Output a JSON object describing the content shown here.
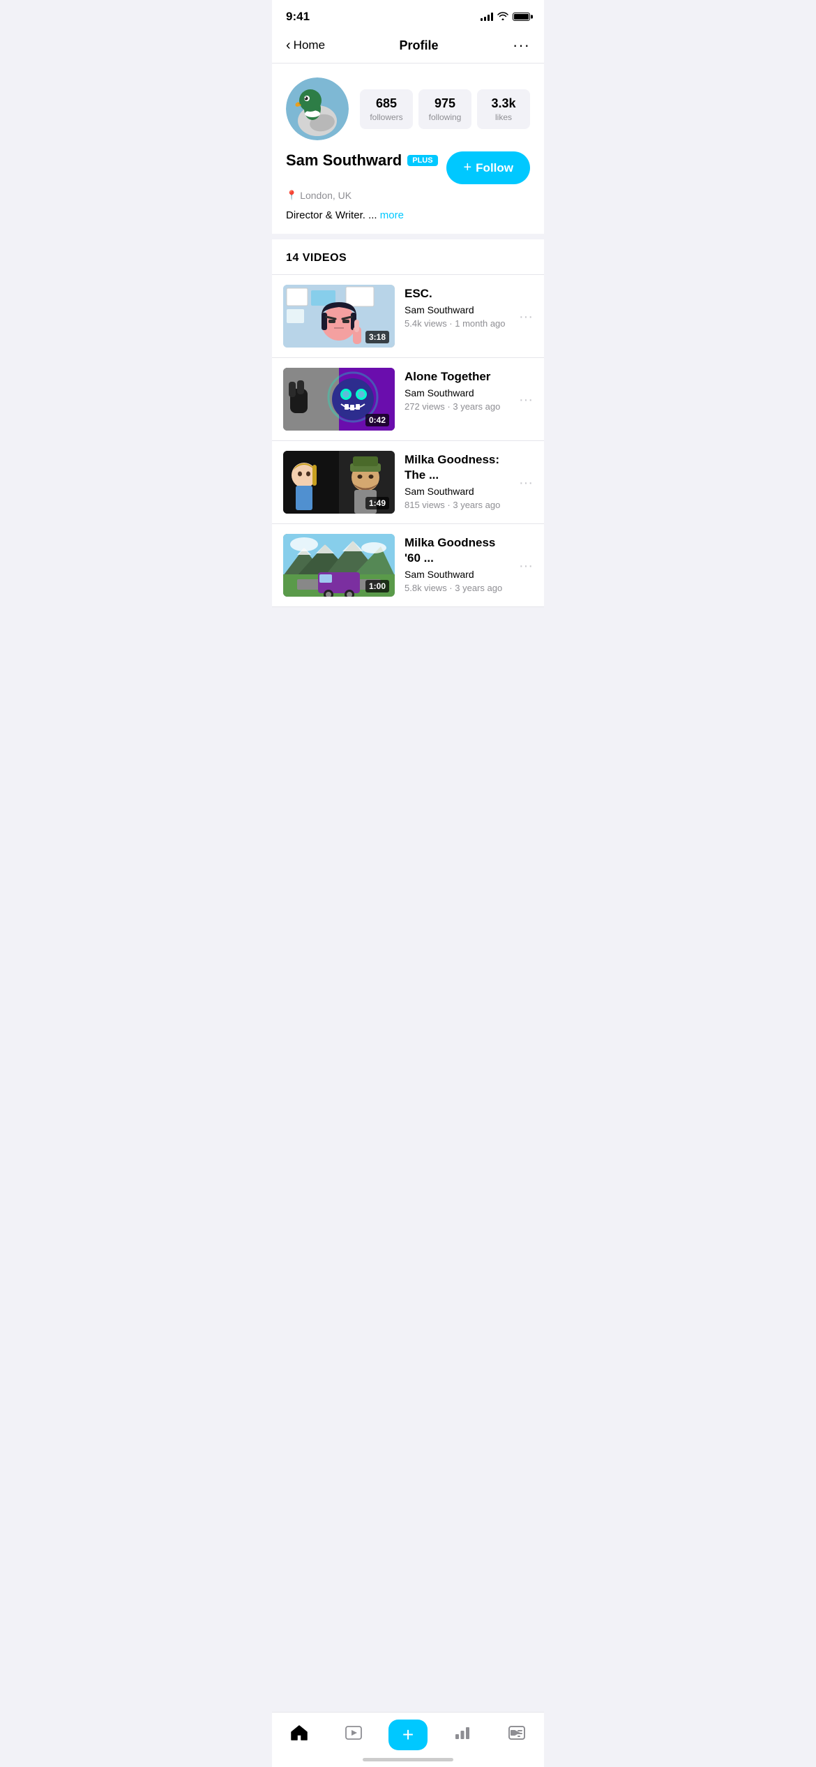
{
  "statusBar": {
    "time": "9:41"
  },
  "navBar": {
    "back_label": "Home",
    "title": "Profile",
    "more": "···"
  },
  "profile": {
    "name": "Sam Southward",
    "badge": "PLUS",
    "location": "London, UK",
    "bio": "Director & Writer.",
    "bio_more": "more",
    "follow_label": "Follow",
    "stats": [
      {
        "number": "685",
        "label": "followers"
      },
      {
        "number": "975",
        "label": "following"
      },
      {
        "number": "3.3k",
        "label": "likes"
      }
    ]
  },
  "videosSection": {
    "header": "14 VIDEOS"
  },
  "videos": [
    {
      "title": "ESC.",
      "author": "Sam Southward",
      "meta": "5.4k views · 1 month ago",
      "duration": "3:18",
      "thumb_type": "esc"
    },
    {
      "title": "Alone Together",
      "author": "Sam Southward",
      "meta": "272 views · 3 years ago",
      "duration": "0:42",
      "thumb_type": "alone"
    },
    {
      "title": "Milka Goodness: The ...",
      "author": "Sam Southward",
      "meta": "815 views · 3 years ago",
      "duration": "1:49",
      "thumb_type": "milka1"
    },
    {
      "title": "Milka Goodness '60 ...",
      "author": "Sam Southward",
      "meta": "5.8k views · 3 years ago",
      "duration": "1:00",
      "thumb_type": "milka2"
    }
  ],
  "bottomNav": {
    "items": [
      {
        "name": "home",
        "icon": "⌂",
        "active": true
      },
      {
        "name": "play",
        "icon": "▷",
        "active": false
      },
      {
        "name": "add",
        "icon": "+",
        "active": false
      },
      {
        "name": "stats",
        "icon": "▤",
        "active": false
      },
      {
        "name": "feed",
        "icon": "▶",
        "active": false
      }
    ]
  }
}
